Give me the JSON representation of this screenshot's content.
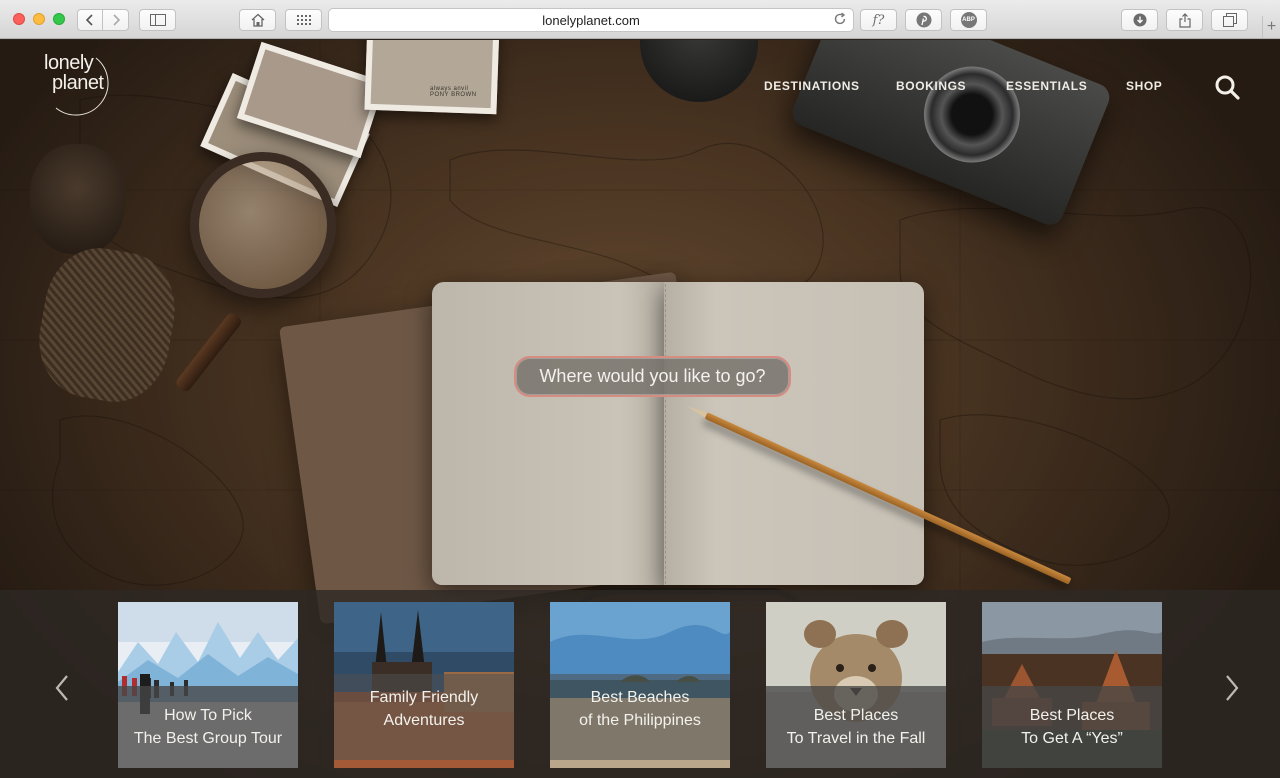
{
  "browser": {
    "url": "lonelyplanet.com",
    "toolbar_icons": [
      "back-icon",
      "forward-icon",
      "sidebar-icon",
      "home-icon",
      "grid-icon",
      "reload-icon",
      "font-icon",
      "pinterest-icon",
      "adblock-icon",
      "download-icon",
      "share-icon",
      "tabs-icon",
      "new-tab-icon"
    ],
    "font_button_label": "f?",
    "adblock_label": "ABP",
    "new_tab_label": "+"
  },
  "site": {
    "logo_line1": "lonely",
    "logo_line2": "planet",
    "nav": [
      "DESTINATIONS",
      "BOOKINGS",
      "ESSENTIALS",
      "SHOP"
    ],
    "search_prompt": "Where would you like to go?",
    "photo_caption_1": "always anvil",
    "photo_caption_2": "PONY BROWN"
  },
  "carousel": {
    "cards": [
      {
        "line1": "How To Pick",
        "line2": "The Best Group Tour"
      },
      {
        "line1": "Family Friendly",
        "line2": "Adventures"
      },
      {
        "line1": "Best Beaches",
        "line2": "of the Philippines"
      },
      {
        "line1": "Best Places",
        "line2": "To Travel in the Fall"
      },
      {
        "line1": "Best Places",
        "line2": "To Get A “Yes”"
      }
    ]
  },
  "colors": {
    "accent_pill_border": "#d78c82",
    "nav_text": "#efece6"
  }
}
